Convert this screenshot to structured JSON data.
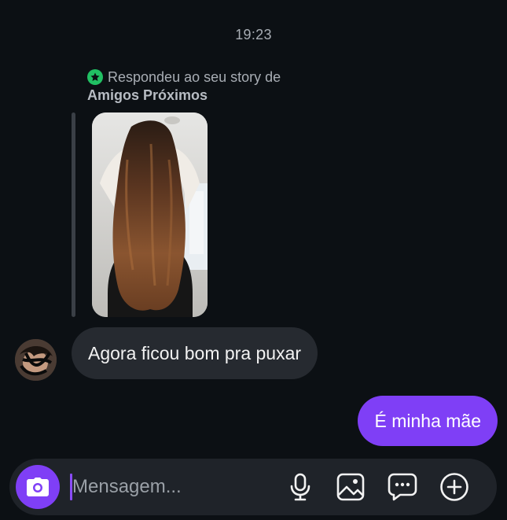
{
  "chat": {
    "timestamp": "19:23",
    "story_reply": {
      "context_line1": "Respondeu ao seu story de",
      "context_line2": "Amigos Próximos",
      "badge_color": "#21c063",
      "badge_icon": "star-icon"
    },
    "messages": [
      {
        "direction": "incoming",
        "text": "Agora ficou bom pra puxar"
      },
      {
        "direction": "outgoing",
        "text": "É minha mãe"
      }
    ]
  },
  "composer": {
    "placeholder": "Mensagem...",
    "camera_icon": "camera-icon",
    "icons": [
      "microphone-icon",
      "gallery-icon",
      "sticker-chat-icon",
      "plus-circle-icon"
    ]
  },
  "theme": {
    "background": "#0c1014",
    "accent": "#7f3ff6",
    "incoming_bubble": "#262a30"
  }
}
